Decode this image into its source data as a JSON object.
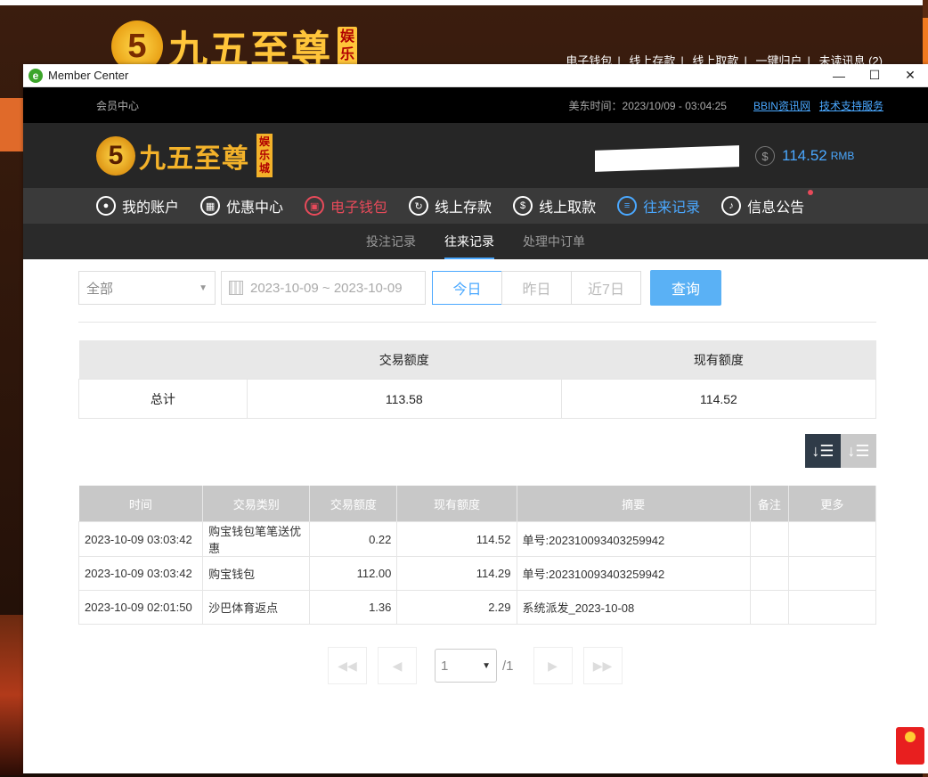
{
  "background": {
    "logo_text": "九五至尊",
    "logo_badge": "娱乐",
    "links": [
      "电子钱包",
      "线上存款",
      "线上取款",
      "一键归户",
      "未读讯息 (2)"
    ],
    "separator": "|"
  },
  "window": {
    "title": "Member Center",
    "minimize": "—",
    "maximize": "☐",
    "close": "✕"
  },
  "topstrip": {
    "member_center": "会员中心",
    "time": "美东时间：2023/10/09 - 03:04:25",
    "link1": "BBIN资讯网",
    "link2": "技术支持服务"
  },
  "header": {
    "logo_text": "九五至尊",
    "logo_badge": "娱乐城",
    "balance_amount": "114.52",
    "balance_unit": "RMB",
    "dollar_icon": "$"
  },
  "nav": {
    "items": [
      {
        "label": "我的账户",
        "icon": "user-icon"
      },
      {
        "label": "优惠中心",
        "icon": "gift-icon"
      },
      {
        "label": "电子钱包",
        "icon": "wallet-icon"
      },
      {
        "label": "线上存款",
        "icon": "deposit-icon"
      },
      {
        "label": "线上取款",
        "icon": "withdraw-icon"
      },
      {
        "label": "往来记录",
        "icon": "records-icon"
      },
      {
        "label": "信息公告",
        "icon": "bell-icon"
      }
    ],
    "accent_red": "#e84a5a",
    "accent_blue": "#4aa8ff"
  },
  "subnav": {
    "tabs": [
      "投注记录",
      "往来记录",
      "处理中订单"
    ]
  },
  "filters": {
    "type_value": "全部",
    "date_range": "2023-10-09 ~ 2023-10-09",
    "today": "今日",
    "yesterday": "昨日",
    "last7": "近7日",
    "query": "查询"
  },
  "summary": {
    "col_trade": "交易额度",
    "col_current": "现有额度",
    "row_label": "总计",
    "trade_total": "113.58",
    "current_total": "114.52"
  },
  "table": {
    "headers": [
      "时间",
      "交易类别",
      "交易额度",
      "现有额度",
      "摘要",
      "备注",
      "更多"
    ],
    "rows": [
      [
        "2023-10-09 03:03:42",
        "购宝钱包笔笔送优惠",
        "0.22",
        "114.52",
        "单号:202310093403259942",
        "",
        ""
      ],
      [
        "2023-10-09 03:03:42",
        "购宝钱包",
        "112.00",
        "114.29",
        "单号:202310093403259942",
        "",
        ""
      ],
      [
        "2023-10-09 02:01:50",
        "沙巴体育返点",
        "1.36",
        "2.29",
        "系统派发_2023-10-08",
        "",
        ""
      ]
    ]
  },
  "pager": {
    "page": "1",
    "total": "/1"
  }
}
